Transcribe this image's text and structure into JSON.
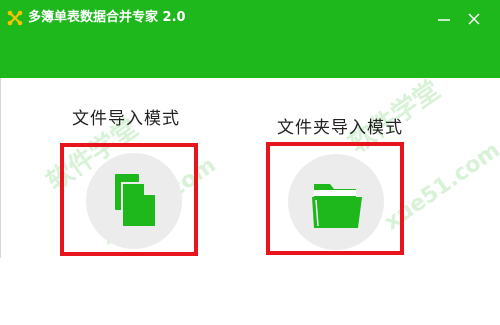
{
  "window": {
    "title": "多簿单表数据合并专家 2.0",
    "accent_color": "#1fb81c",
    "minimize_icon": "minimize-icon",
    "close_icon": "close-icon"
  },
  "modes": {
    "file_import": {
      "label": "文件导入模式",
      "icon": "files-icon"
    },
    "folder_import": {
      "label": "文件夹导入模式",
      "icon": "folder-icon"
    },
    "highlight_color": "#e8141c"
  },
  "watermarks": [
    "软件学堂",
    "xue51.com",
    "软件学堂",
    "xue51.com"
  ]
}
